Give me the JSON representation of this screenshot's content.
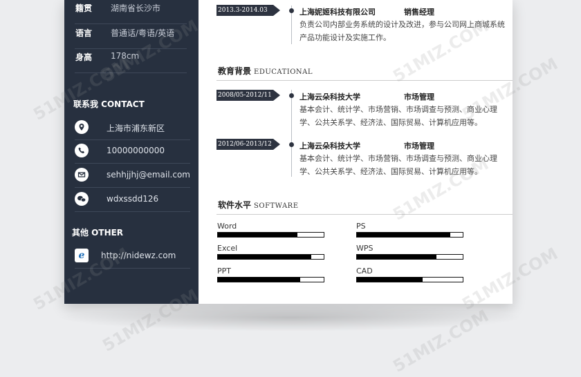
{
  "sidebar": {
    "personal": [
      {
        "key": "籍贯",
        "value": "湖南省长沙市"
      },
      {
        "key": "语言",
        "value": "普通话/粤语/英语"
      },
      {
        "key": "身高",
        "value": "178cm"
      }
    ],
    "contact_title": "联系我 CONTACT",
    "contacts": [
      {
        "icon": "location-icon",
        "value": "上海市浦东新区"
      },
      {
        "icon": "phone-icon",
        "value": "10000000000"
      },
      {
        "icon": "email-icon",
        "value": "sehhjjhj@email.com"
      },
      {
        "icon": "wechat-icon",
        "value": "wdxssdd126"
      }
    ],
    "other_title": "其他 OTHER",
    "other": [
      {
        "icon": "ie-browser-icon",
        "value": "http://nidewz.com"
      }
    ]
  },
  "work": {
    "date": "2013.3-2014.03",
    "org": "上海妮姬科技有限公司",
    "role": "销售经理",
    "desc": "负责公司内部业务系统的设计及改进，参与公司网上商城系统产品功能设计及实施工作。"
  },
  "education": {
    "title_cn": "教育背景",
    "title_en": "EDUCATIONAL",
    "items": [
      {
        "date": "2008/05-2012/11",
        "org": "上海云朵科技大学",
        "major": "市场管理",
        "desc": "基本会计、统计学、市场营销、市场调查与预测、商业心理学、公共关系学、经济法、国际贸易、计算机应用等。"
      },
      {
        "date": "2012/06-2013/12",
        "org": "上海云朵科技大学",
        "major": "市场管理",
        "desc": "基本会计、统计学、市场营销、市场调查与预测、商业心理学、公共关系学、经济法、国际贸易、计算机应用等。"
      }
    ]
  },
  "software": {
    "title_cn": "软件水平",
    "title_en": "SOFTWARE",
    "skills": [
      {
        "name": "Word",
        "level": 0.75
      },
      {
        "name": "PS",
        "level": 0.88
      },
      {
        "name": "Excel",
        "level": 0.88
      },
      {
        "name": "WPS",
        "level": 0.75
      },
      {
        "name": "PPT",
        "level": 0.78
      },
      {
        "name": "CAD",
        "level": 0.62
      }
    ]
  },
  "watermark_text": "51MIZ.COM",
  "colors": {
    "sidebar": "#27303f",
    "accent": "#2d3340"
  }
}
